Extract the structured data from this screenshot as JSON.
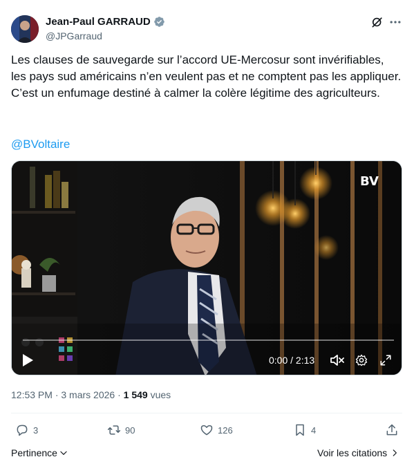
{
  "author": {
    "name": "Jean-Paul GARRAUD",
    "handle": "@JPGarraud",
    "verified": true
  },
  "tweet": {
    "text": "Les clauses de sauvegarde sur l’accord UE-Mercosur sont invérifiables, les pays sud américains n’en veulent pas et ne comptent pas les appliquer. C’est un enfumage destiné à calmer la colère légitime des agriculteurs.",
    "mention": "@BVoltaire"
  },
  "video": {
    "time": "0:00 / 2:13",
    "watermark": "BV",
    "progress": 0
  },
  "meta": {
    "timestamp": "12:53 PM · 3 mars 2026 · ",
    "views_count": "1 549",
    "views_label": " vues"
  },
  "actions": {
    "replies": "3",
    "retweets": "90",
    "likes": "126",
    "bookmarks": "4"
  },
  "footer": {
    "relevance_label": "Pertinence",
    "quotes_label": "Voir les citations"
  },
  "colors": {
    "link": "#1d9bf0",
    "secondary_text": "#536471",
    "verified": "#829aab"
  }
}
